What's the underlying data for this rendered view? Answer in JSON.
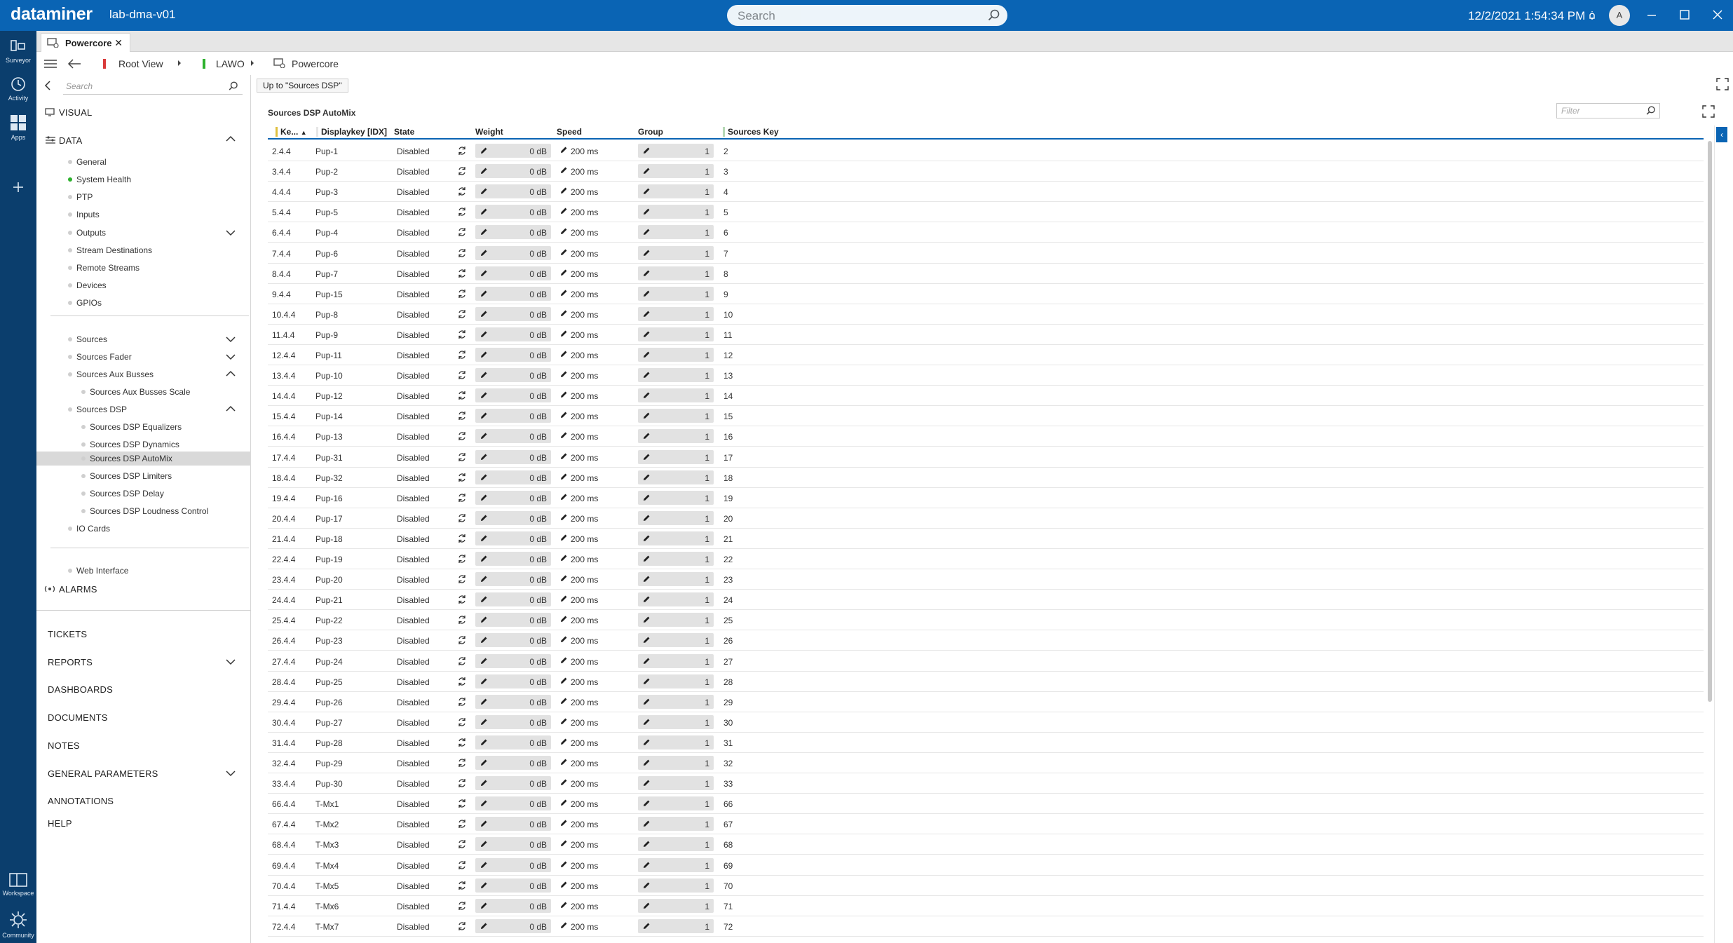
{
  "titlebar": {
    "logo": "dataminer",
    "app_name": "lab-dma-v01",
    "search_placeholder": "Search",
    "clock": "12/2/2021 1:54:34 PM",
    "avatar_initial": "A"
  },
  "navbar": {
    "items": [
      {
        "label": "Surveyor",
        "icon": "surveyor-icon"
      },
      {
        "label": "Activity",
        "icon": "activity-icon"
      },
      {
        "label": "Apps",
        "icon": "apps-icon"
      },
      {
        "label": "Workspace",
        "icon": "workspace-icon"
      },
      {
        "label": "Community",
        "icon": "community-icon"
      }
    ]
  },
  "tabs": [
    {
      "label": "Powercore"
    }
  ],
  "breadcrumb": {
    "items": [
      "Root View",
      "LAWO",
      "Powercore"
    ]
  },
  "tree": {
    "search_placeholder": "Search",
    "visual": "VISUAL",
    "data": "DATA",
    "data_items": [
      "General",
      "System Health",
      "PTP",
      "Inputs",
      "Outputs",
      "Stream Destinations",
      "Remote Streams",
      "Devices",
      "GPIOs"
    ],
    "sources_items": [
      "Sources",
      "Sources Fader",
      "Sources Aux Busses"
    ],
    "aux_child": "Sources Aux Busses Scale",
    "dsp": "Sources DSP",
    "dsp_children": [
      "Sources DSP Equalizers",
      "Sources DSP Dynamics",
      "Sources DSP AutoMix",
      "Sources DSP Limiters",
      "Sources DSP Delay",
      "Sources DSP Loudness Control"
    ],
    "io_cards": "IO Cards",
    "web_interface": "Web Interface",
    "alarms": "ALARMS",
    "modules": [
      "TICKETS",
      "REPORTS",
      "DASHBOARDS",
      "DOCUMENTS",
      "NOTES",
      "GENERAL PARAMETERS",
      "ANNOTATIONS",
      "HELP"
    ]
  },
  "main": {
    "up_button": "Up to \"Sources DSP\"",
    "table_title": "Sources DSP AutoMix",
    "filter_placeholder": "Filter",
    "columns": [
      "Ke...",
      "Displaykey [IDX]",
      "State",
      "Weight",
      "Speed",
      "Group",
      "Sources Key"
    ],
    "rows": [
      [
        "2.4.4",
        "Pup-1",
        "Disabled",
        "0 dB",
        "200 ms",
        "1",
        "2"
      ],
      [
        "3.4.4",
        "Pup-2",
        "Disabled",
        "0 dB",
        "200 ms",
        "1",
        "3"
      ],
      [
        "4.4.4",
        "Pup-3",
        "Disabled",
        "0 dB",
        "200 ms",
        "1",
        "4"
      ],
      [
        "5.4.4",
        "Pup-5",
        "Disabled",
        "0 dB",
        "200 ms",
        "1",
        "5"
      ],
      [
        "6.4.4",
        "Pup-4",
        "Disabled",
        "0 dB",
        "200 ms",
        "1",
        "6"
      ],
      [
        "7.4.4",
        "Pup-6",
        "Disabled",
        "0 dB",
        "200 ms",
        "1",
        "7"
      ],
      [
        "8.4.4",
        "Pup-7",
        "Disabled",
        "0 dB",
        "200 ms",
        "1",
        "8"
      ],
      [
        "9.4.4",
        "Pup-15",
        "Disabled",
        "0 dB",
        "200 ms",
        "1",
        "9"
      ],
      [
        "10.4.4",
        "Pup-8",
        "Disabled",
        "0 dB",
        "200 ms",
        "1",
        "10"
      ],
      [
        "11.4.4",
        "Pup-9",
        "Disabled",
        "0 dB",
        "200 ms",
        "1",
        "11"
      ],
      [
        "12.4.4",
        "Pup-11",
        "Disabled",
        "0 dB",
        "200 ms",
        "1",
        "12"
      ],
      [
        "13.4.4",
        "Pup-10",
        "Disabled",
        "0 dB",
        "200 ms",
        "1",
        "13"
      ],
      [
        "14.4.4",
        "Pup-12",
        "Disabled",
        "0 dB",
        "200 ms",
        "1",
        "14"
      ],
      [
        "15.4.4",
        "Pup-14",
        "Disabled",
        "0 dB",
        "200 ms",
        "1",
        "15"
      ],
      [
        "16.4.4",
        "Pup-13",
        "Disabled",
        "0 dB",
        "200 ms",
        "1",
        "16"
      ],
      [
        "17.4.4",
        "Pup-31",
        "Disabled",
        "0 dB",
        "200 ms",
        "1",
        "17"
      ],
      [
        "18.4.4",
        "Pup-32",
        "Disabled",
        "0 dB",
        "200 ms",
        "1",
        "18"
      ],
      [
        "19.4.4",
        "Pup-16",
        "Disabled",
        "0 dB",
        "200 ms",
        "1",
        "19"
      ],
      [
        "20.4.4",
        "Pup-17",
        "Disabled",
        "0 dB",
        "200 ms",
        "1",
        "20"
      ],
      [
        "21.4.4",
        "Pup-18",
        "Disabled",
        "0 dB",
        "200 ms",
        "1",
        "21"
      ],
      [
        "22.4.4",
        "Pup-19",
        "Disabled",
        "0 dB",
        "200 ms",
        "1",
        "22"
      ],
      [
        "23.4.4",
        "Pup-20",
        "Disabled",
        "0 dB",
        "200 ms",
        "1",
        "23"
      ],
      [
        "24.4.4",
        "Pup-21",
        "Disabled",
        "0 dB",
        "200 ms",
        "1",
        "24"
      ],
      [
        "25.4.4",
        "Pup-22",
        "Disabled",
        "0 dB",
        "200 ms",
        "1",
        "25"
      ],
      [
        "26.4.4",
        "Pup-23",
        "Disabled",
        "0 dB",
        "200 ms",
        "1",
        "26"
      ],
      [
        "27.4.4",
        "Pup-24",
        "Disabled",
        "0 dB",
        "200 ms",
        "1",
        "27"
      ],
      [
        "28.4.4",
        "Pup-25",
        "Disabled",
        "0 dB",
        "200 ms",
        "1",
        "28"
      ],
      [
        "29.4.4",
        "Pup-26",
        "Disabled",
        "0 dB",
        "200 ms",
        "1",
        "29"
      ],
      [
        "30.4.4",
        "Pup-27",
        "Disabled",
        "0 dB",
        "200 ms",
        "1",
        "30"
      ],
      [
        "31.4.4",
        "Pup-28",
        "Disabled",
        "0 dB",
        "200 ms",
        "1",
        "31"
      ],
      [
        "32.4.4",
        "Pup-29",
        "Disabled",
        "0 dB",
        "200 ms",
        "1",
        "32"
      ],
      [
        "33.4.4",
        "Pup-30",
        "Disabled",
        "0 dB",
        "200 ms",
        "1",
        "33"
      ],
      [
        "66.4.4",
        "T-Mx1",
        "Disabled",
        "0 dB",
        "200 ms",
        "1",
        "66"
      ],
      [
        "67.4.4",
        "T-Mx2",
        "Disabled",
        "0 dB",
        "200 ms",
        "1",
        "67"
      ],
      [
        "68.4.4",
        "T-Mx3",
        "Disabled",
        "0 dB",
        "200 ms",
        "1",
        "68"
      ],
      [
        "69.4.4",
        "T-Mx4",
        "Disabled",
        "0 dB",
        "200 ms",
        "1",
        "69"
      ],
      [
        "70.4.4",
        "T-Mx5",
        "Disabled",
        "0 dB",
        "200 ms",
        "1",
        "70"
      ],
      [
        "71.4.4",
        "T-Mx6",
        "Disabled",
        "0 dB",
        "200 ms",
        "1",
        "71"
      ],
      [
        "72.4.4",
        "T-Mx7",
        "Disabled",
        "0 dB",
        "200 ms",
        "1",
        "72"
      ]
    ]
  },
  "colors": {
    "accent": "#0a64b4",
    "navbar": "#0b3e6d",
    "status_ok": "#2db12d"
  }
}
